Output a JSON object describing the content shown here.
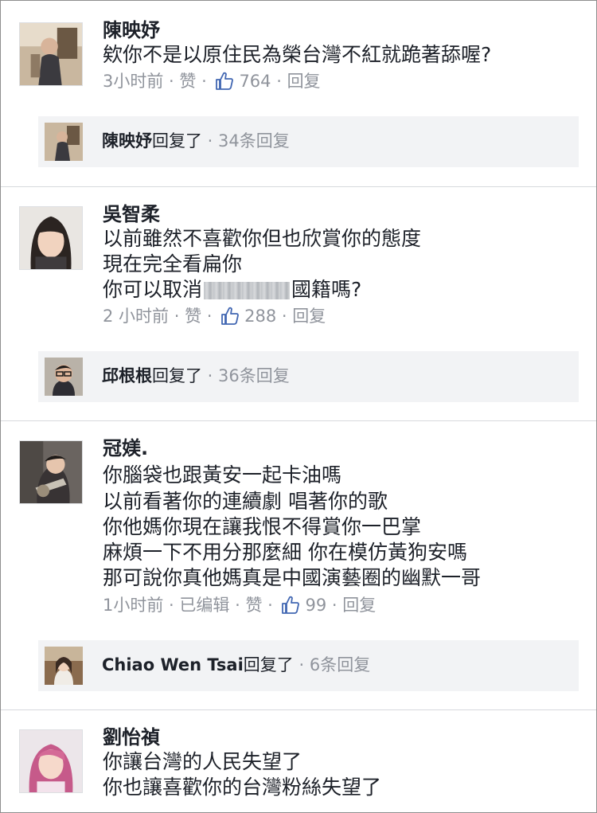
{
  "comments": [
    {
      "name": "陳映妤",
      "lines": [
        "欸你不是以原住民為榮台灣不紅就跪著舔喔?"
      ],
      "meta": {
        "time": "3小时前",
        "edited": "",
        "like": "赞",
        "likes": "764",
        "reply": "回复"
      },
      "reply": {
        "name": "陳映妤",
        "action": "回复了",
        "count": "34条回复"
      }
    },
    {
      "name": "吳智柔",
      "lines": [
        "以前雖然不喜歡你但也欣賞你的態度",
        "現在完全看扁你",
        "你可以取消",
        "國籍嗎?"
      ],
      "meta": {
        "time": "2 小时前",
        "edited": "",
        "like": "赞",
        "likes": "288",
        "reply": "回复"
      },
      "reply": {
        "name": "邱根根",
        "action": "回复了",
        "count": "36条回复"
      }
    },
    {
      "name": "冠媄.",
      "lines": [
        "你腦袋也跟黃安一起卡油嗎",
        "以前看著你的連續劇 唱著你的歌",
        "你他媽你現在讓我恨不得賞你一巴掌",
        "麻煩一下不用分那麼細 你在模仿黃狗安嗎",
        "那可說你真他媽真是中國演藝圈的幽默一哥"
      ],
      "meta": {
        "time": "1小时前",
        "edited": "已编辑",
        "like": "赞",
        "likes": "99",
        "reply": "回复"
      },
      "reply": {
        "name": "Chiao Wen Tsai",
        "action": "回复了",
        "count": "6条回复"
      }
    },
    {
      "name": "劉怡禎",
      "lines": [
        "你讓台灣的人民失望了",
        "你也讓喜歡你的台灣粉絲失望了"
      ]
    }
  ],
  "sep": " · ",
  "icons": {
    "like": "thumbs-up-icon"
  },
  "colors": {
    "meta": "#90949c",
    "like_blue": "#4267b2",
    "reply_bg": "#f2f3f5",
    "divider": "#d7d9dd"
  }
}
